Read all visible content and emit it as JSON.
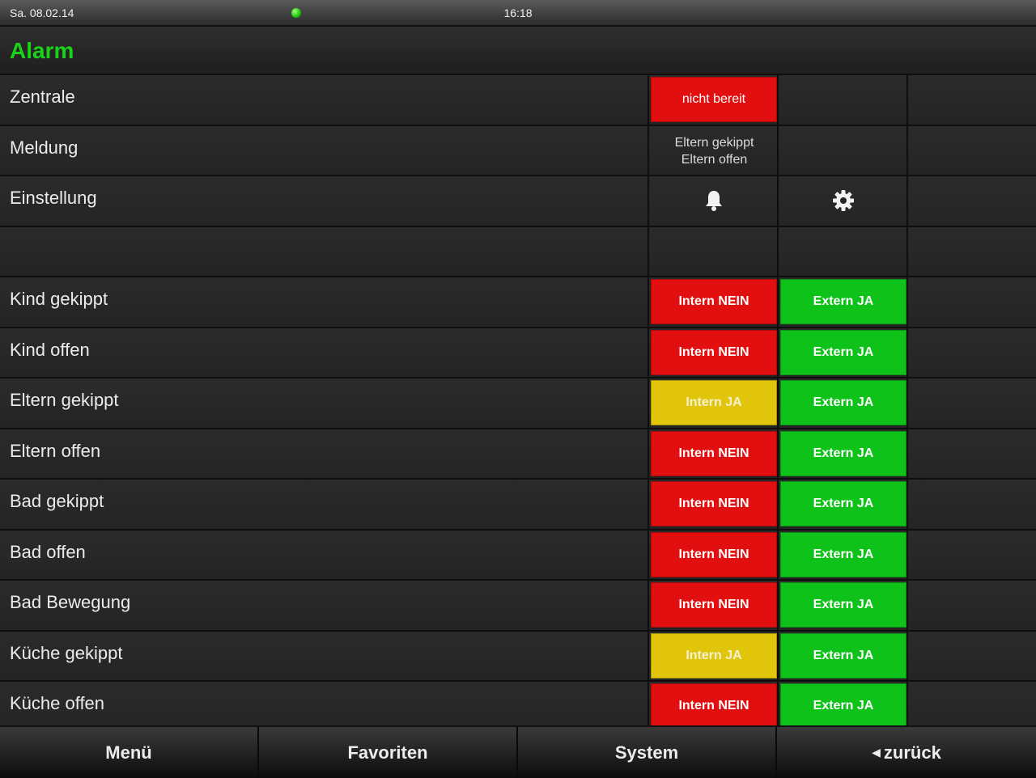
{
  "status": {
    "date": "Sa. 08.02.14",
    "time": "16:18",
    "indicator_color": "#19c40a"
  },
  "header": {
    "title": "Alarm"
  },
  "zentrale": {
    "label": "Zentrale",
    "status": "nicht bereit"
  },
  "meldung": {
    "label": "Meldung",
    "line1": "Eltern gekippt",
    "line2": "Eltern offen"
  },
  "einstellung": {
    "label": "Einstellung",
    "icon1": "bell-icon",
    "icon2": "gear-icon"
  },
  "rows": [
    {
      "label": "Kind gekippt",
      "intern": "Intern NEIN",
      "intern_state": "red",
      "extern": "Extern JA",
      "extern_state": "green"
    },
    {
      "label": "Kind offen",
      "intern": "Intern NEIN",
      "intern_state": "red",
      "extern": "Extern JA",
      "extern_state": "green"
    },
    {
      "label": "Eltern gekippt",
      "intern": "Intern JA",
      "intern_state": "yellow",
      "extern": "Extern JA",
      "extern_state": "green"
    },
    {
      "label": "Eltern offen",
      "intern": "Intern NEIN",
      "intern_state": "red",
      "extern": "Extern JA",
      "extern_state": "green"
    },
    {
      "label": "Bad gekippt",
      "intern": "Intern NEIN",
      "intern_state": "red",
      "extern": "Extern JA",
      "extern_state": "green"
    },
    {
      "label": "Bad offen",
      "intern": "Intern NEIN",
      "intern_state": "red",
      "extern": "Extern JA",
      "extern_state": "green"
    },
    {
      "label": "Bad Bewegung",
      "intern": "Intern NEIN",
      "intern_state": "red",
      "extern": "Extern JA",
      "extern_state": "green"
    },
    {
      "label": "Küche gekippt",
      "intern": "Intern JA",
      "intern_state": "yellow",
      "extern": "Extern JA",
      "extern_state": "green"
    },
    {
      "label": "Küche offen",
      "intern": "Intern NEIN",
      "intern_state": "red",
      "extern": "Extern JA",
      "extern_state": "green"
    }
  ],
  "nav": {
    "menu": "Menü",
    "favorites": "Favoriten",
    "system": "System",
    "back": "zurück"
  },
  "colors": {
    "accent": "#19d319",
    "red": "#e10f0f",
    "green": "#0fc21a",
    "yellow": "#e1c50a"
  }
}
